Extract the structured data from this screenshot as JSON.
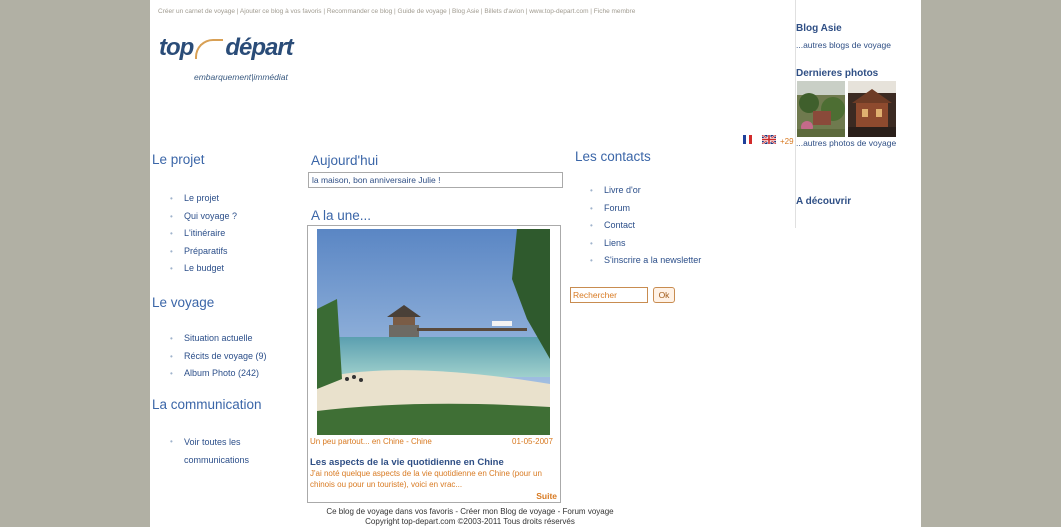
{
  "top_links": "Créer un carnet de voyage | Ajouter ce blog à vos favoris | Recommander ce blog | Guide de voyage | Blog Asie | Billets d'avion | www.top-depart.com | Fiche membre",
  "logo": {
    "word1": "top",
    "word2": "départ",
    "tagline": "embarquement|immédiat"
  },
  "left": {
    "section1": {
      "title": "Le projet",
      "items": [
        "Le projet",
        "Qui voyage ?",
        "L'itinéraire",
        "Préparatifs",
        "Le budget"
      ]
    },
    "section2": {
      "title": "Le voyage",
      "items": [
        "Situation actuelle",
        "Récits de voyage (9)",
        "Album Photo (242)"
      ]
    },
    "section3": {
      "title": "La communication",
      "items": [
        "Voir toutes les",
        "communications"
      ]
    }
  },
  "center": {
    "today_title": "Aujourd'hui",
    "today_text": "la maison, bon anniversaire Julie !",
    "news_title": "A la une...",
    "photo_caption_left": "Un peu partout... en Chine - Chine",
    "photo_caption_date": "01-05-2007",
    "article_title": "Les aspects de la vie quotidienne en Chine",
    "article_text": "J'ai noté quelque aspects de la vie quotidienne en Chine (pour un chinois ou pour un touriste), voici en vrac...",
    "more_label": "Suite"
  },
  "contacts": {
    "title": "Les contacts",
    "items": [
      "Livre d'or",
      "Forum",
      "Contact",
      "Liens",
      "S'inscrire a la newsletter"
    ],
    "search_value": "Rechercher",
    "ok_label": "Ok"
  },
  "lang_count": "+29",
  "right": {
    "blog_title": "Blog Asie",
    "blog_link": "...autres blogs de voyage",
    "photos_title": "Dernieres photos",
    "photos_link": "...autres photos de voyage",
    "discover_title": "A découvrir"
  },
  "footer": {
    "line1": "Ce blog de voyage dans vos favoris - Créer mon Blog de voyage - Forum voyage",
    "line2": "Copyright top-depart.com ©2003-2011 Tous droits réservés"
  },
  "colors": {
    "background": "#b1b0a4",
    "link_blue": "#2f4f85",
    "heading_blue": "#3b66a8",
    "accent_orange": "#d87a22"
  }
}
